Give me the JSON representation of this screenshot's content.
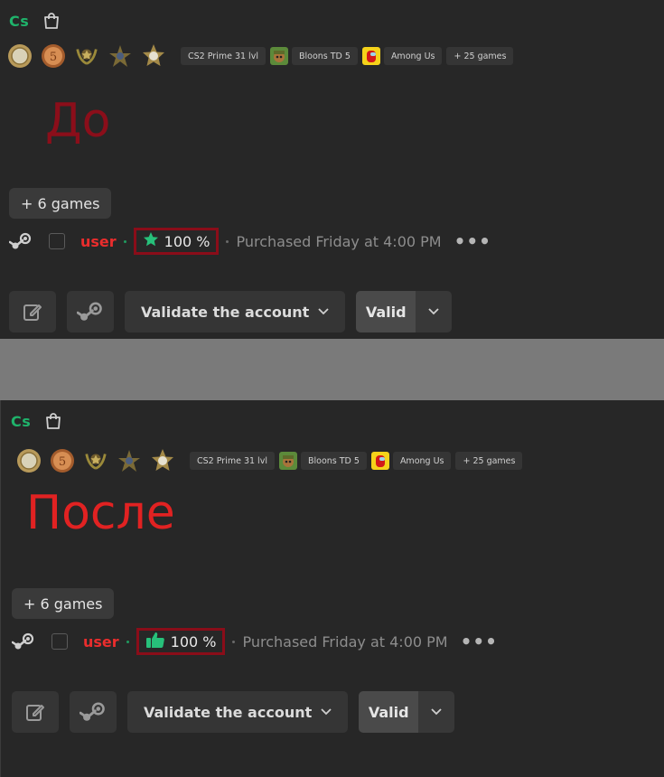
{
  "app": {
    "logo_text": "Cs"
  },
  "tags": {
    "cs2": "CS2 Prime 31 lvl",
    "bloons": "Bloons TD 5",
    "among": "Among Us",
    "more": "+ 25 games"
  },
  "labels": {
    "before": "До",
    "after": "После"
  },
  "games_button": "+ 6 games",
  "user": "user",
  "rating": "100 %",
  "purchased": "Purchased Friday at 4:00 PM",
  "more_menu": "•••",
  "validate_label": "Validate the account",
  "valid_label": "Valid",
  "colors": {
    "background": "#272727",
    "divider": "#7a7a7a",
    "user": "#ea2d2d",
    "accent_green": "#1fb36b",
    "highlight_border": "#8a0d19",
    "label_before": "#8b0e1a",
    "label_after": "#e12222"
  },
  "icons": {
    "bag": "shopping-bag-icon",
    "steam": "steam-icon",
    "edit": "edit-icon",
    "star": "star-icon",
    "thumbs_up": "thumbs-up-icon",
    "chevron": "chevron-down-icon"
  }
}
